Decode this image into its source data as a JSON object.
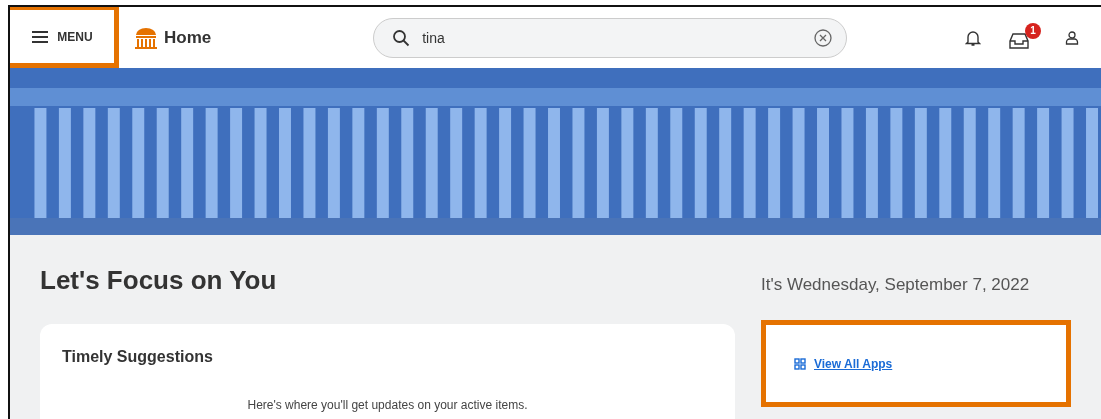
{
  "header": {
    "menu_label": "MENU",
    "title": "Home",
    "search": {
      "value": "tina"
    },
    "inbox_badge": "1"
  },
  "main": {
    "heading": "Let's Focus on You",
    "date": "It's Wednesday, September 7, 2022"
  },
  "timely_suggestions": {
    "title": "Timely Suggestions",
    "message": "Here's where you'll get updates on your active items."
  },
  "apps": {
    "link": "View All Apps"
  }
}
